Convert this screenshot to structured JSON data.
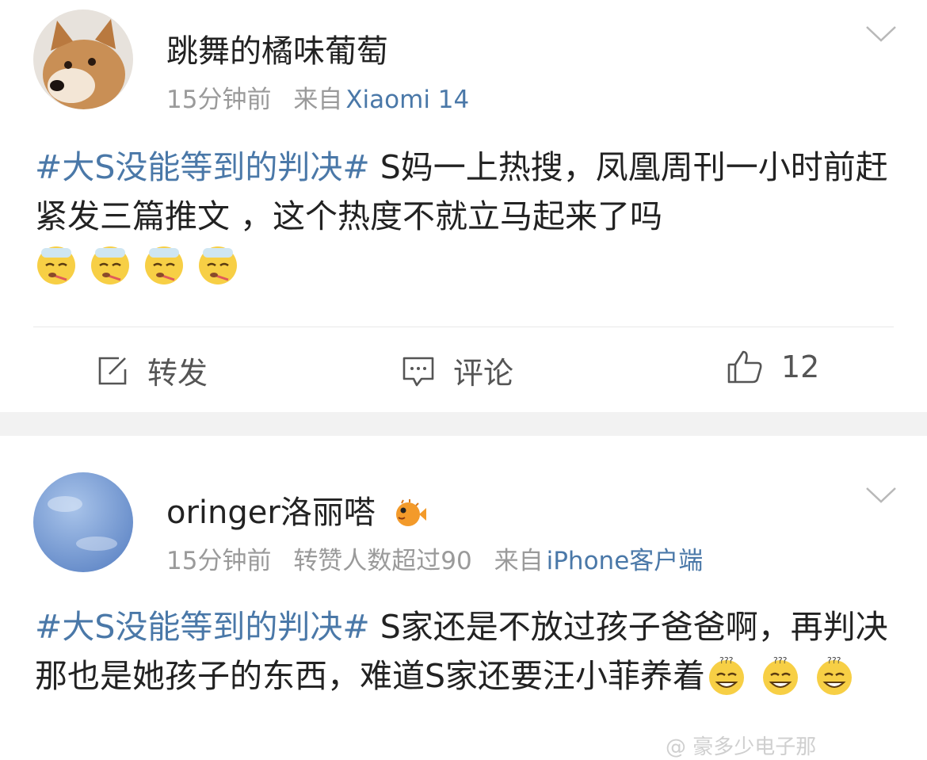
{
  "posts": [
    {
      "username": "跳舞的橘味葡萄",
      "time": "15分钟前",
      "source_prefix": "来自",
      "source": "Xiaomi 14",
      "hashtag": "#大S没能等到的判决#",
      "text": " S妈一上热搜，凤凰周刊一小时前赶紧发三篇推文 ，这个热度不就立马起来了吗",
      "emoji": [
        "sick-face",
        "sick-face",
        "sick-face",
        "sick-face"
      ],
      "actions": {
        "repost": "转发",
        "comment": "评论",
        "like_count": "12"
      }
    },
    {
      "username": "oringer洛丽嗒",
      "time": "15分钟前",
      "extra": "转赞人数超过90",
      "source_prefix": "来自",
      "source": "iPhone客户端",
      "hashtag": "#大S没能等到的判决#",
      "text": " S家还是不放过孩子爸爸啊，再判决那也是她孩子的东西，难道S家还要汪小菲养着",
      "emoji": [
        "confused-grin",
        "confused-grin",
        "confused-grin"
      ]
    }
  ],
  "watermark": "@ 豪多少电子那"
}
